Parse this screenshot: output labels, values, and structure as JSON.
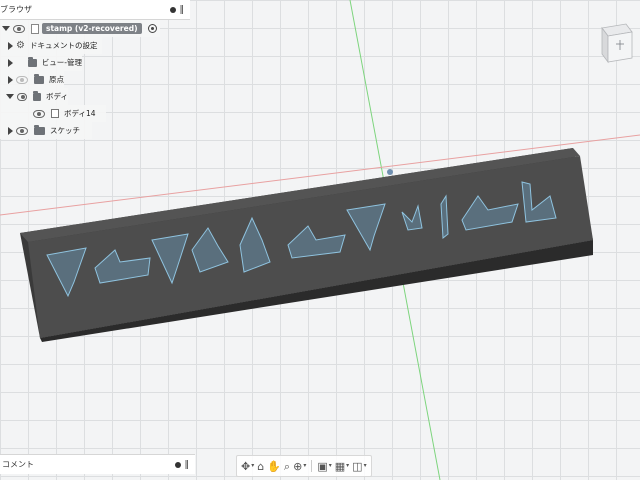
{
  "browser": {
    "title": "ブラウザ",
    "root": {
      "label": "stamp (v2-recovered)"
    },
    "items": [
      {
        "label": "ドキュメントの設定",
        "icon": "gear-icon"
      },
      {
        "label": "ビュー-管理",
        "icon": "folder-icon"
      },
      {
        "label": "原点",
        "icon": "folder-icon"
      },
      {
        "label": "ボディ",
        "icon": "folder-icon"
      },
      {
        "label": "ボディ14",
        "icon": "body-icon"
      },
      {
        "label": "スケッチ",
        "icon": "folder-icon"
      }
    ]
  },
  "comments": {
    "title": "コメント"
  },
  "toolbar": {
    "tools": [
      "orbit-icon",
      "look-at-icon",
      "pan-icon",
      "zoom-icon",
      "zoom-window-icon",
      "display-settings-icon",
      "grid-settings-icon",
      "viewports-icon"
    ]
  },
  "colors": {
    "stamp_top": "#4f4f4f",
    "stamp_front": "#3b3b3b",
    "relief_highlight": "#6fa8c9",
    "grid": "#dcdee0",
    "axis_green": "#7cd47c",
    "axis_red": "#e89090"
  }
}
